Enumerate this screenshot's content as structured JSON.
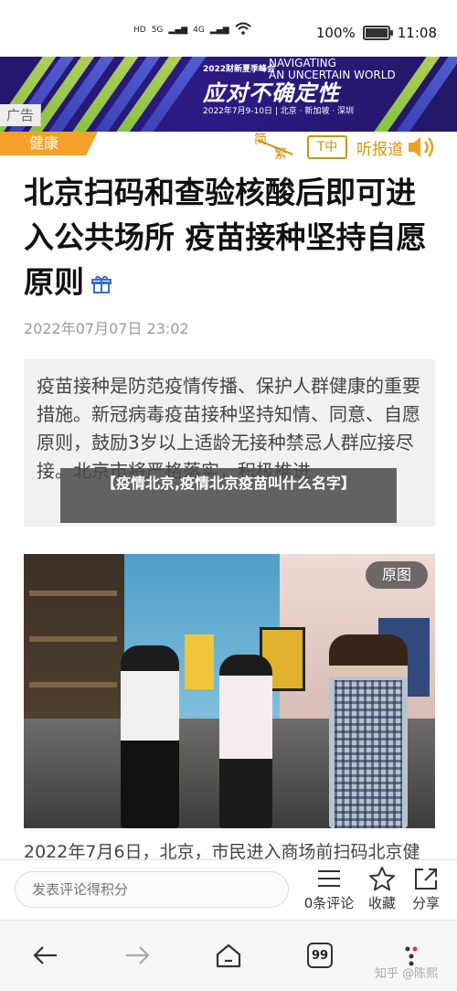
{
  "status_bar": {
    "time": "11:08",
    "battery_percent": "100%",
    "battery_level": 1.0,
    "network_1": "5G",
    "network_2": "4G"
  },
  "ad_banner": {
    "ad_label": "广告",
    "event_year": "2022财新夏季峰会",
    "event_english": "NAVIGATING\nAN UNCERTAIN WORLD",
    "event_title": "应对不确定性",
    "event_date": "2022年7月9-10日 | 北京 · 新加坡 · 深圳"
  },
  "toolbar": {
    "category": "健康",
    "simplified": "简",
    "traditional": "繁",
    "font_size": "T中",
    "listen": "听报道"
  },
  "article": {
    "title": "北京扫码和查验核酸后即可进入公共场所 疫苗接种坚持自愿原则",
    "date": "2022年07月07日 23:02",
    "summary": "疫苗接种是防范疫情传播、保护人群健康的重要措施。新冠病毒疫苗接种坚持知情、同意、自愿原则，鼓励3岁以上适龄无接种禁忌人群应接尽接。北京市将严格落实，积极推进",
    "overlay_title": "【疫情北京,疫情北京疫苗叫什么名字】",
    "photo_badge": "原图",
    "photo_caption": "2022年7月6日，北京，市民进入商场前扫码北京健"
  },
  "comment_bar": {
    "placeholder": "发表评论得积分",
    "comments_label": "0条评论",
    "favorite_label": "收藏",
    "share_label": "分享"
  },
  "nav_bar": {
    "tabs_count": "99",
    "watermark": "知乎 @陈熙"
  },
  "colors": {
    "accent": "#f3a12a",
    "gold": "#c8940e",
    "banner_bg": "#2d1a85"
  }
}
